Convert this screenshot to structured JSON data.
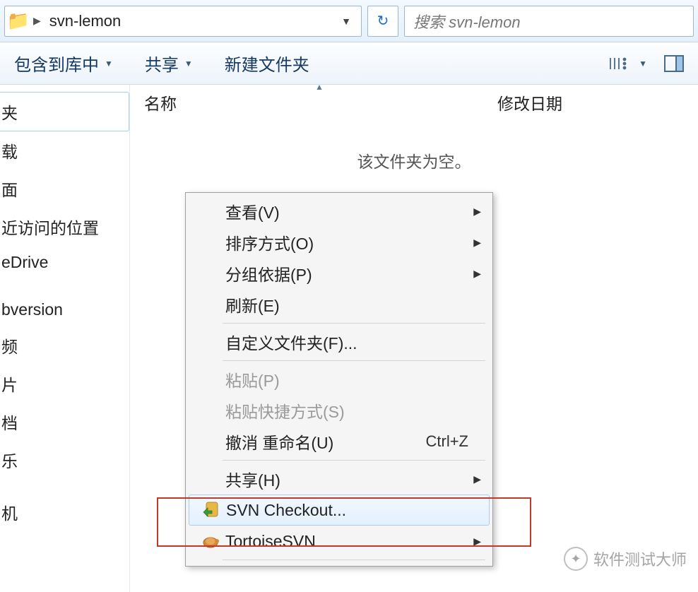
{
  "address": {
    "folder_name": "svn-lemon"
  },
  "search": {
    "placeholder": "搜索 svn-lemon"
  },
  "toolbar": {
    "include": "包含到库中",
    "share": "共享",
    "new_folder": "新建文件夹"
  },
  "columns": {
    "name": "名称",
    "date": "修改日期"
  },
  "content": {
    "empty": "该文件夹为空。"
  },
  "sidebar": {
    "items": [
      "夹",
      "载",
      "面",
      "近访问的位置",
      "eDrive",
      "",
      "bversion",
      "频",
      "片",
      "档",
      "乐",
      "",
      "机"
    ]
  },
  "context_menu": {
    "view": "查看(V)",
    "sort": "排序方式(O)",
    "group": "分组依据(P)",
    "refresh": "刷新(E)",
    "customize": "自定义文件夹(F)...",
    "paste": "粘贴(P)",
    "paste_shortcut": "粘贴快捷方式(S)",
    "undo_rename": "撤消 重命名(U)",
    "undo_shortcut": "Ctrl+Z",
    "share": "共享(H)",
    "svn_checkout": "SVN Checkout...",
    "tortoise_svn": "TortoiseSVN"
  },
  "watermark": {
    "text": "软件测试大师"
  }
}
